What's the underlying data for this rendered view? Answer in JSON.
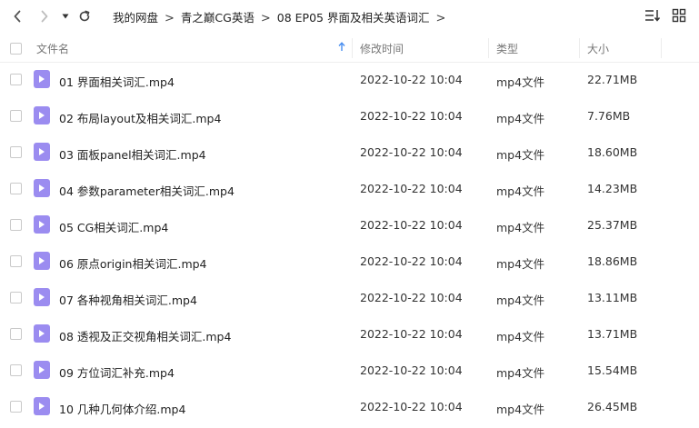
{
  "breadcrumb": {
    "items": [
      "我的网盘",
      "青之巅CG英语",
      "08 EP05 界面及相关英语词汇"
    ],
    "separator": ">"
  },
  "header": {
    "name": "文件名",
    "modified": "修改时间",
    "type": "类型",
    "size": "大小"
  },
  "files": [
    {
      "name": "01 界面相关词汇.mp4",
      "date": "2022-10-22 10:04",
      "type": "mp4文件",
      "size": "22.71MB"
    },
    {
      "name": "02 布局layout及相关词汇.mp4",
      "date": "2022-10-22 10:04",
      "type": "mp4文件",
      "size": "7.76MB"
    },
    {
      "name": "03 面板panel相关词汇.mp4",
      "date": "2022-10-22 10:04",
      "type": "mp4文件",
      "size": "18.60MB"
    },
    {
      "name": "04 参数parameter相关词汇.mp4",
      "date": "2022-10-22 10:04",
      "type": "mp4文件",
      "size": "14.23MB"
    },
    {
      "name": "05 CG相关词汇.mp4",
      "date": "2022-10-22 10:04",
      "type": "mp4文件",
      "size": "25.37MB"
    },
    {
      "name": "06 原点origin相关词汇.mp4",
      "date": "2022-10-22 10:04",
      "type": "mp4文件",
      "size": "18.86MB"
    },
    {
      "name": "07 各种视角相关词汇.mp4",
      "date": "2022-10-22 10:04",
      "type": "mp4文件",
      "size": "13.11MB"
    },
    {
      "name": "08 透视及正交视角相关词汇.mp4",
      "date": "2022-10-22 10:04",
      "type": "mp4文件",
      "size": "13.71MB"
    },
    {
      "name": "09 方位词汇补充.mp4",
      "date": "2022-10-22 10:04",
      "type": "mp4文件",
      "size": "15.54MB"
    },
    {
      "name": "10 几种几何体介绍.mp4",
      "date": "2022-10-22 10:04",
      "type": "mp4文件",
      "size": "26.45MB"
    }
  ],
  "icons": {
    "back": "chevron-left-icon",
    "forward": "chevron-right-icon",
    "history": "caret-down-icon",
    "refresh": "refresh-icon",
    "sort_direction": "arrow-up-icon",
    "sort_menu": "sort-list-icon",
    "grid_view": "grid-view-icon",
    "file": "video-file-icon"
  },
  "colors": {
    "file_icon": "#9b8cf0",
    "sort_arrow": "#4a8ff0"
  }
}
